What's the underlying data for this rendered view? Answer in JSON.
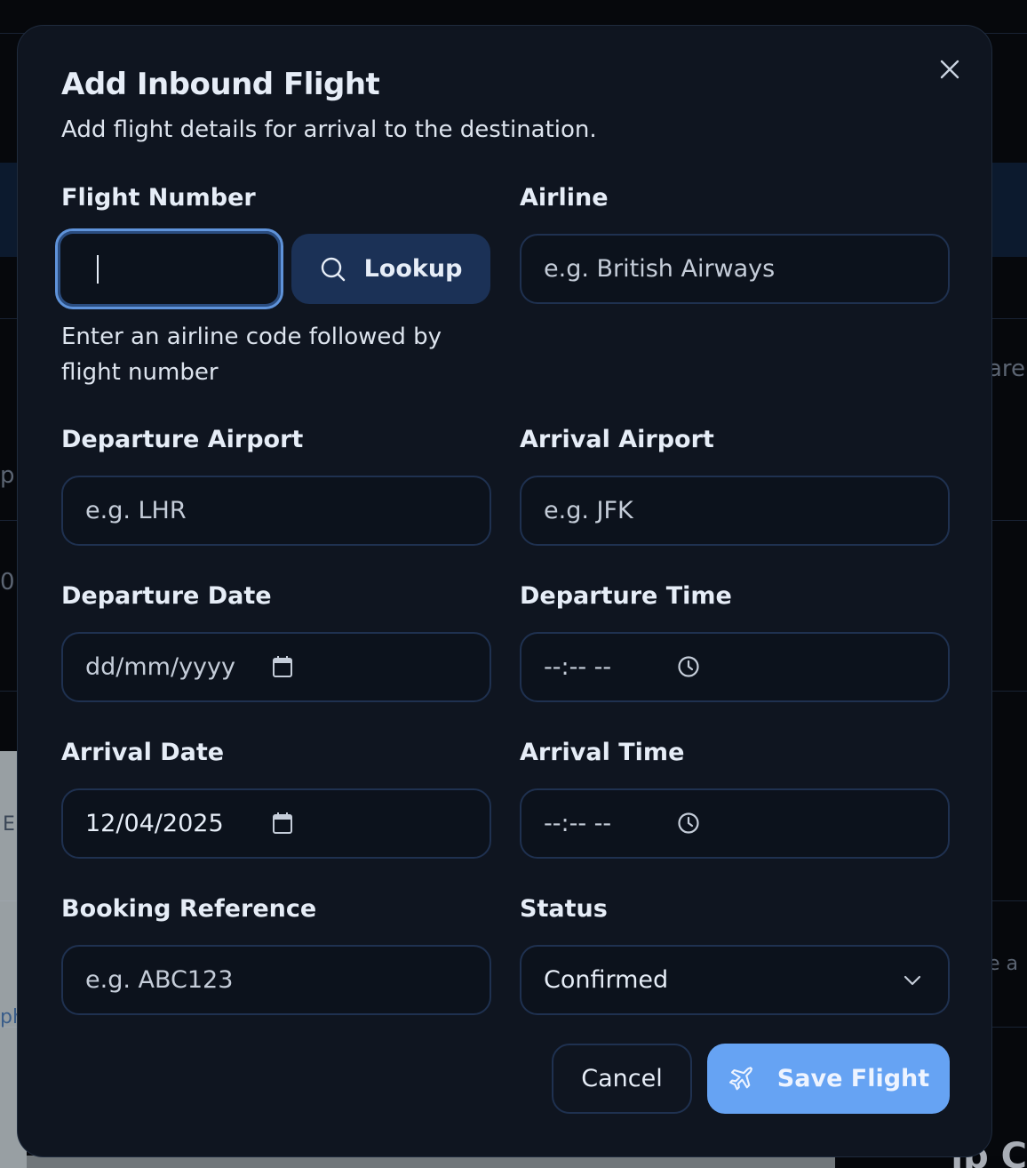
{
  "dialog": {
    "title": "Add Inbound Flight",
    "subtitle": "Add flight details for arrival to the destination.",
    "close_icon": "close-icon"
  },
  "fields": {
    "flight_number": {
      "label": "Flight Number",
      "value": "",
      "hint": "Enter an airline code followed by flight number"
    },
    "lookup_button": {
      "label": "Lookup",
      "icon": "search-icon"
    },
    "airline": {
      "label": "Airline",
      "placeholder": "e.g. British Airways"
    },
    "departure_airport": {
      "label": "Departure Airport",
      "placeholder": "e.g. LHR"
    },
    "arrival_airport": {
      "label": "Arrival Airport",
      "placeholder": "e.g. JFK"
    },
    "departure_date": {
      "label": "Departure Date",
      "placeholder": "dd/mm/yyyy",
      "icon": "calendar-icon"
    },
    "departure_time": {
      "label": "Departure Time",
      "placeholder": "--:-- --",
      "icon": "clock-icon"
    },
    "arrival_date": {
      "label": "Arrival Date",
      "value": "12/04/2025",
      "icon": "calendar-icon"
    },
    "arrival_time": {
      "label": "Arrival Time",
      "placeholder": "--:-- --",
      "icon": "clock-icon"
    },
    "booking_reference": {
      "label": "Booking Reference",
      "placeholder": "e.g. ABC123"
    },
    "status": {
      "label": "Status",
      "value": "Confirmed",
      "icon": "chevron-down-icon"
    }
  },
  "actions": {
    "cancel": "Cancel",
    "save": "Save Flight",
    "save_icon": "plane-icon"
  },
  "background_fragments": {
    "right_1": "are",
    "left_1": "p",
    "left_2": "0",
    "left_3": "E",
    "left_4": "ph",
    "right_2": "e a",
    "bottom_right": "ip C"
  },
  "colors": {
    "modal_bg": "#0f1520",
    "accent": "#66a3f3",
    "lookup_bg": "#1b3156",
    "focus_ring": "#5f93da"
  }
}
